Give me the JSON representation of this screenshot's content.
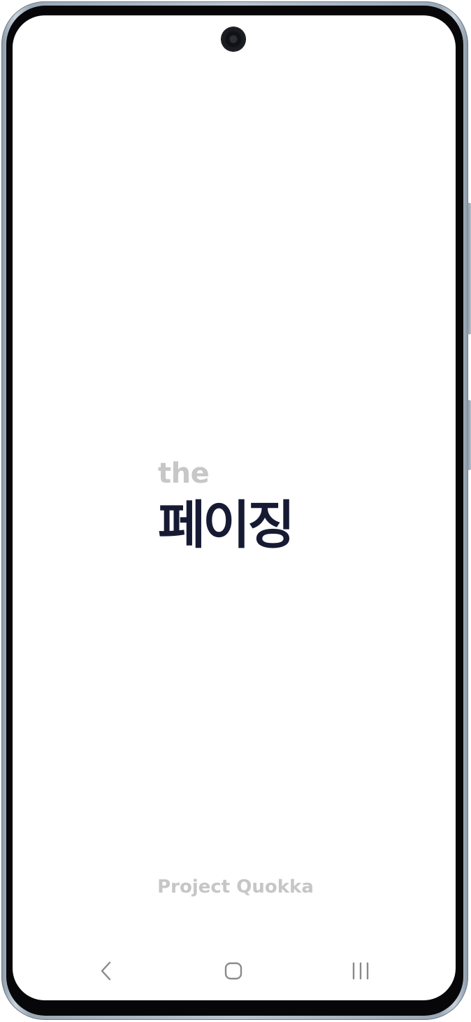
{
  "splash": {
    "logo_prefix": "the",
    "logo_title": "페이징",
    "footer": "Project Quokka"
  },
  "navigation_bar": {
    "back_icon": "chevron-left-icon",
    "home_icon": "rounded-square-home-icon",
    "recents_icon": "three-bars-recents-icon"
  },
  "colors": {
    "logo_title": "#171a33",
    "logo_prefix": "#c7c7c7",
    "footer": "#c6c6c6",
    "background": "#ffffff",
    "nav_icons": "#8a8a8a"
  }
}
